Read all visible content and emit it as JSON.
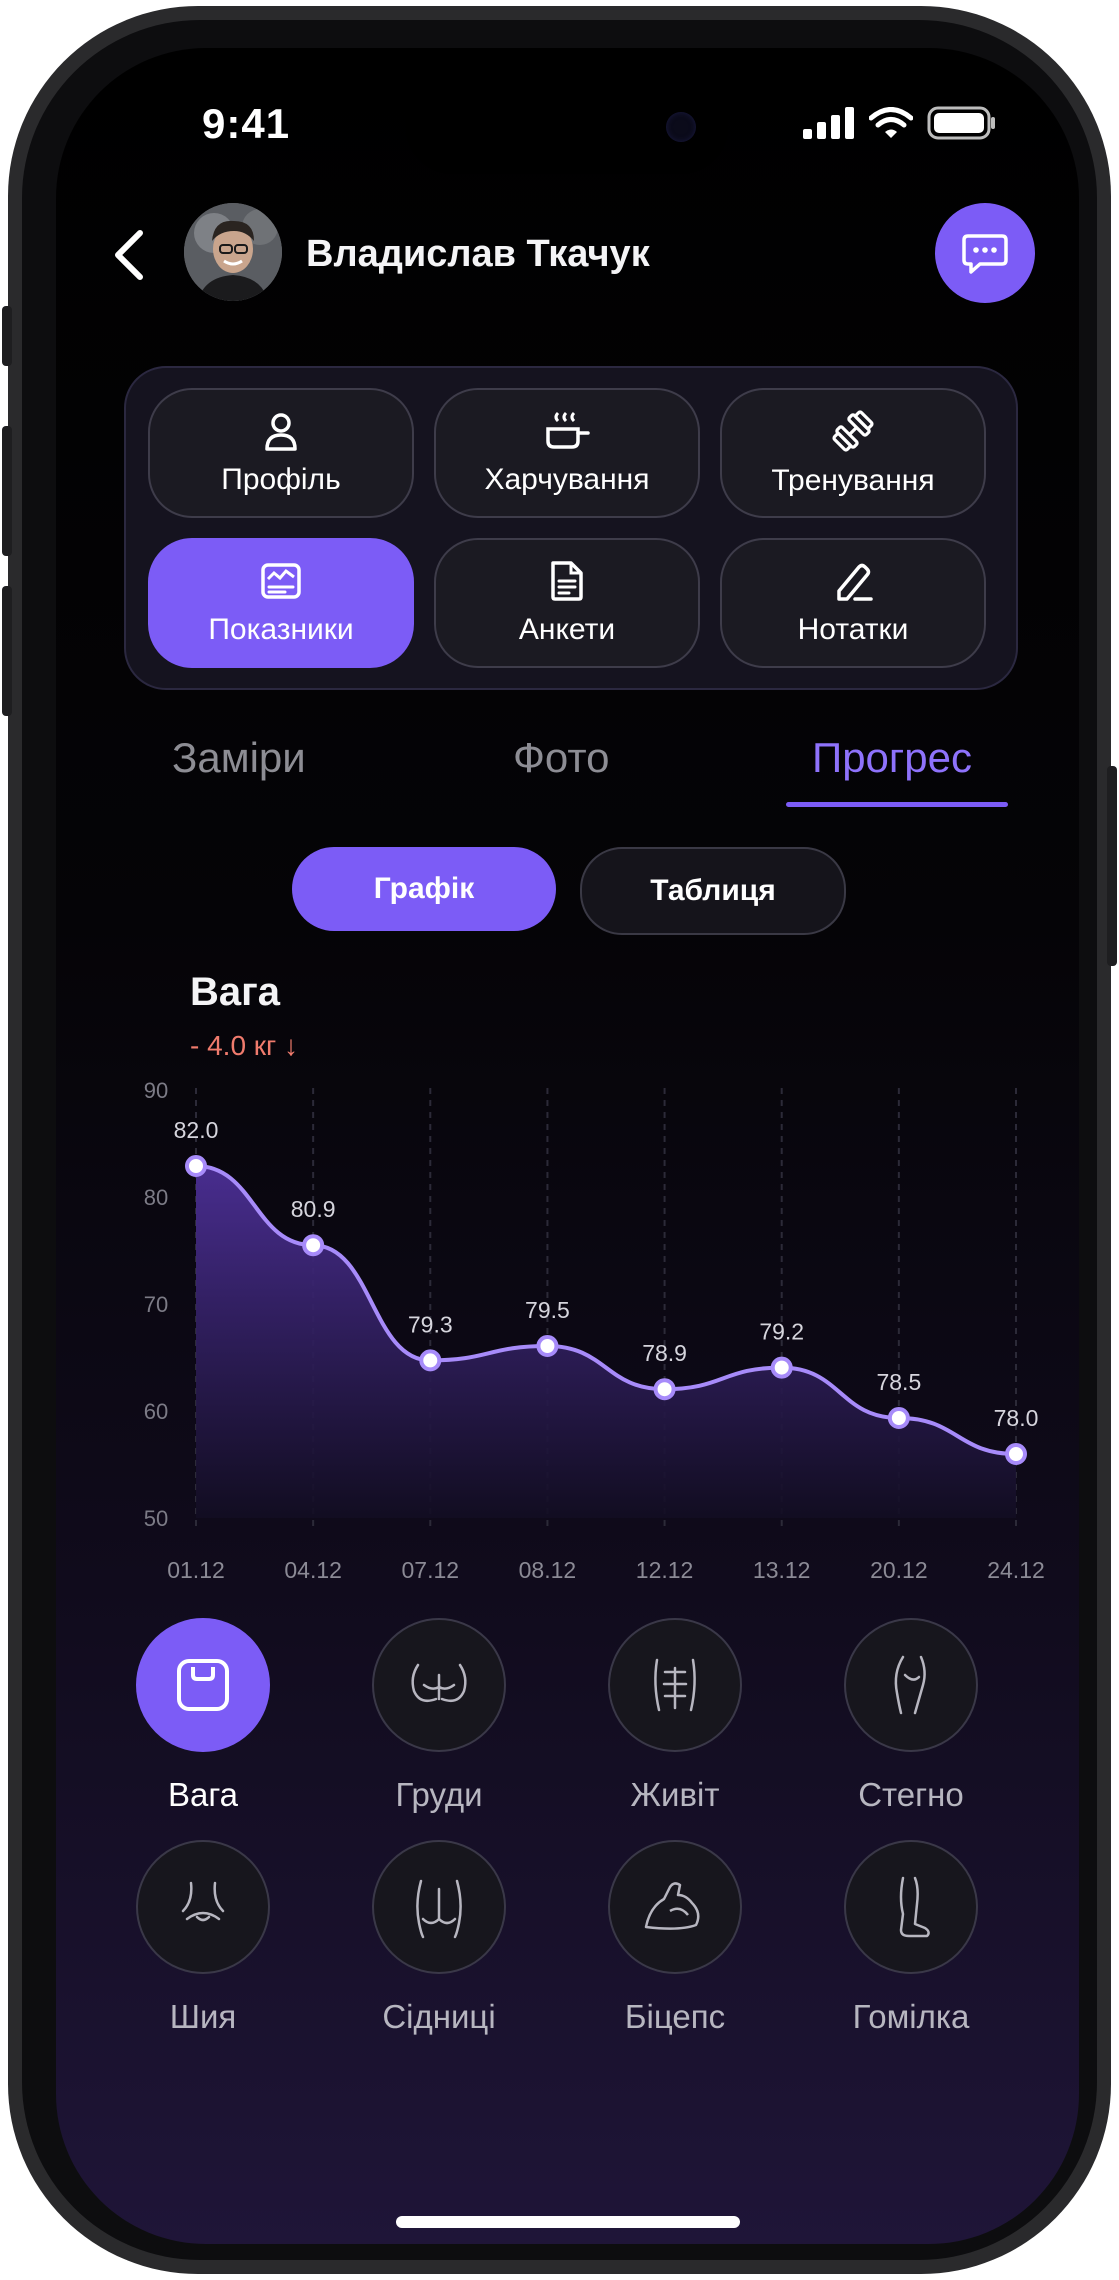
{
  "status": {
    "time": "9:41"
  },
  "header": {
    "user_name": "Владислав Ткачук"
  },
  "menu": [
    {
      "label": "Профіль",
      "icon": "user-icon",
      "active": false
    },
    {
      "label": "Харчування",
      "icon": "cooking-pot-icon",
      "active": false
    },
    {
      "label": "Тренування",
      "icon": "dumbbell-icon",
      "active": false
    },
    {
      "label": "Показники",
      "icon": "dashboard-icon",
      "active": true
    },
    {
      "label": "Анкети",
      "icon": "document-icon",
      "active": false
    },
    {
      "label": "Нотатки",
      "icon": "pencil-icon",
      "active": false
    }
  ],
  "tabs": [
    {
      "label": "Заміри",
      "active": false
    },
    {
      "label": "Фото",
      "active": false
    },
    {
      "label": "Прогрес",
      "active": true
    }
  ],
  "view_toggle": {
    "chart_label": "Графік",
    "table_label": "Таблиця",
    "selected": "Графік"
  },
  "chart_data": {
    "type": "area",
    "title": "Вага",
    "change": "- 4.0 кг ↓",
    "categories": [
      "01.12",
      "04.12",
      "07.12",
      "08.12",
      "12.12",
      "13.12",
      "20.12",
      "24.12"
    ],
    "values": [
      82.0,
      80.9,
      79.3,
      79.5,
      78.9,
      79.2,
      78.5,
      78.0
    ],
    "value_labels": [
      "82.0",
      "80.9",
      "79.3",
      "79.5",
      "78.9",
      "79.2",
      "78.5",
      "78.0"
    ],
    "y_ticks": [
      "90",
      "80",
      "70",
      "60",
      "50"
    ],
    "colors": {
      "line": "#a78bfa",
      "fill_top": "#4c2f96",
      "fill_bottom": "#120d22"
    }
  },
  "categories": [
    {
      "label": "Вага",
      "icon": "scale-icon",
      "active": true
    },
    {
      "label": "Груди",
      "icon": "chest-icon",
      "active": false
    },
    {
      "label": "Живіт",
      "icon": "abs-icon",
      "active": false
    },
    {
      "label": "Стегно",
      "icon": "thigh-icon",
      "active": false
    },
    {
      "label": "Шия",
      "icon": "neck-icon",
      "active": false
    },
    {
      "label": "Сідниці",
      "icon": "glutes-icon",
      "active": false
    },
    {
      "label": "Біцепс",
      "icon": "bicep-icon",
      "active": false
    },
    {
      "label": "Гомілка",
      "icon": "shin-icon",
      "active": false
    }
  ],
  "colors": {
    "accent": "#7c5cf6",
    "negative": "#f07b6d"
  }
}
